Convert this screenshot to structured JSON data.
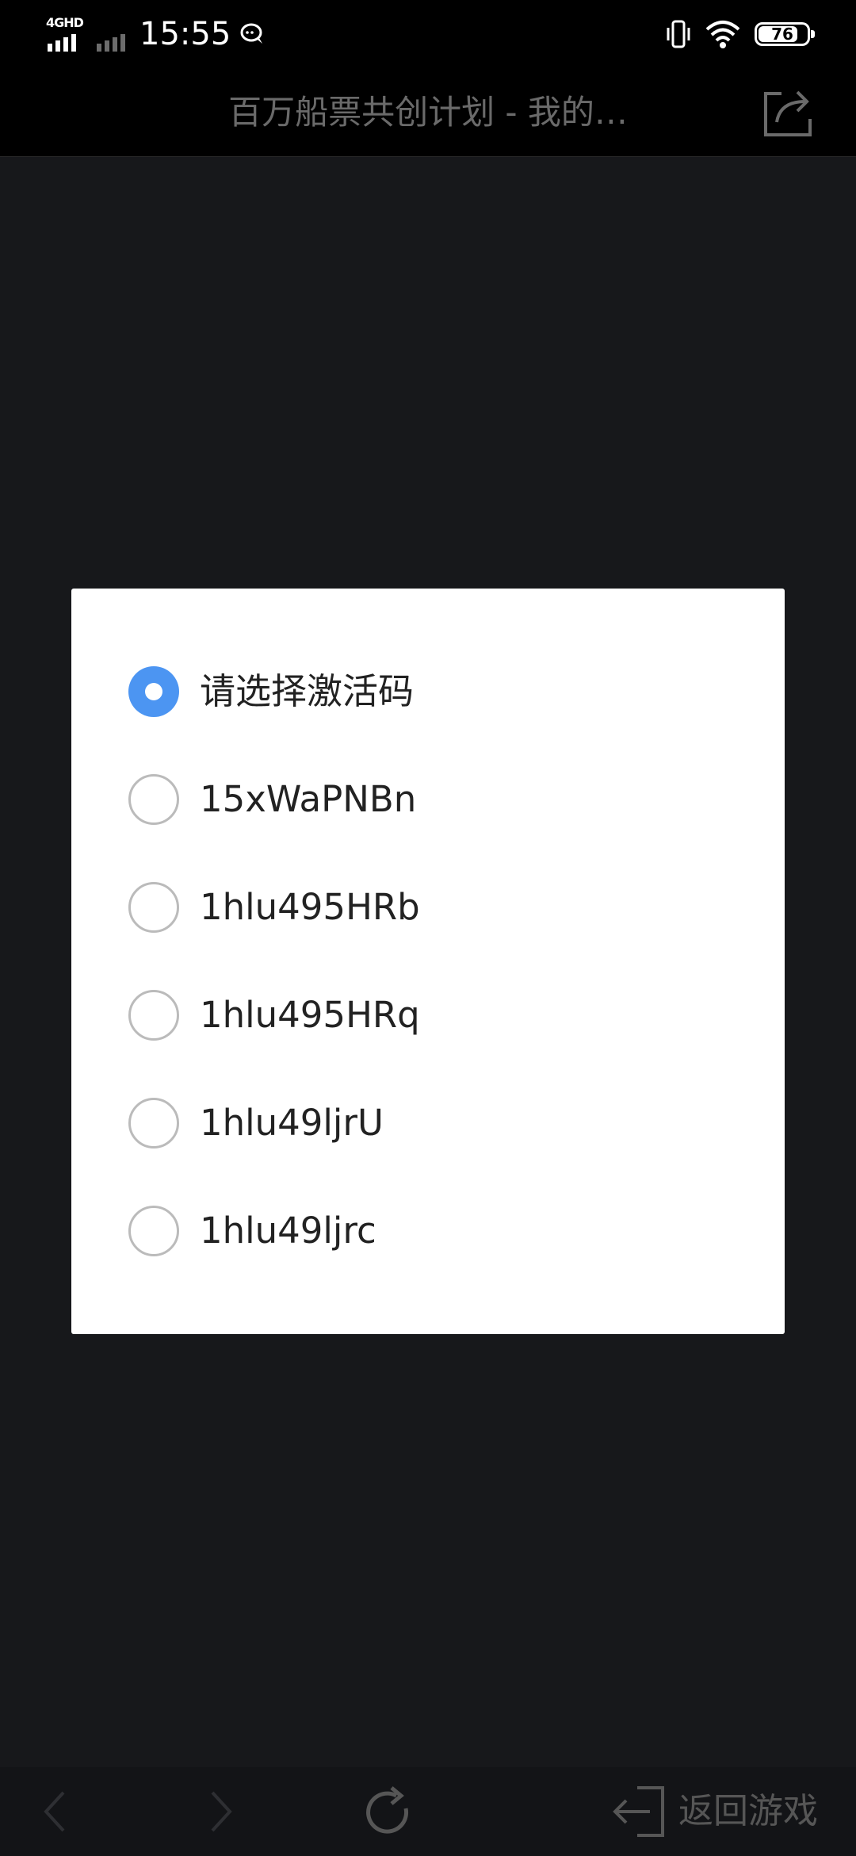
{
  "status_bar": {
    "network_label": "4GHD",
    "time": "15:55",
    "battery_level": "76",
    "battery_fraction": 0.76
  },
  "header": {
    "title": "百万船票共创计划 - 我的…",
    "share_icon": "share-icon"
  },
  "dialog": {
    "options": [
      {
        "label": "请选择激活码",
        "selected": true
      },
      {
        "label": "15xWaPNBn",
        "selected": false
      },
      {
        "label": "1hlu495HRb",
        "selected": false
      },
      {
        "label": "1hlu495HRq",
        "selected": false
      },
      {
        "label": "1hlu49ljrU",
        "selected": false
      },
      {
        "label": "1hlu49ljrc",
        "selected": false
      }
    ],
    "accent_color": "#4c95f2"
  },
  "bottom_bar": {
    "back_icon": "chevron-left-icon",
    "forward_icon": "chevron-right-icon",
    "refresh_icon": "refresh-icon",
    "return_label": "返回游戏"
  }
}
